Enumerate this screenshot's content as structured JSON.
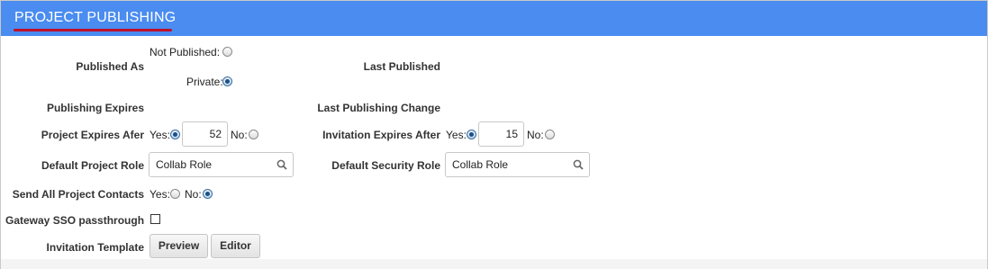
{
  "header": {
    "title": "PROJECT PUBLISHING"
  },
  "published_as": {
    "label": "Published As",
    "not_published_label": "Not Published:",
    "private_label": "Private:",
    "selected": "private"
  },
  "last_published": {
    "label": "Last Published"
  },
  "publishing_expires": {
    "label": "Publishing Expires"
  },
  "last_publishing_change": {
    "label": "Last Publishing Change"
  },
  "project_expires_after": {
    "label": "Project Expires Afer",
    "yes_label": "Yes:",
    "no_label": "No:",
    "selected": "yes",
    "value": "52"
  },
  "invitation_expires_after": {
    "label": "Invitation Expires After",
    "yes_label": "Yes:",
    "no_label": "No:",
    "selected": "yes",
    "value": "15"
  },
  "default_project_role": {
    "label": "Default Project Role",
    "value": "Collab Role"
  },
  "default_security_role": {
    "label": "Default Security Role",
    "value": "Collab Role"
  },
  "send_all_project_contacts": {
    "label": "Send All Project Contacts",
    "yes_label": "Yes:",
    "no_label": "No:",
    "selected": "no"
  },
  "gateway_sso": {
    "label": "Gateway SSO passthrough",
    "checked": false
  },
  "invitation_template": {
    "label": "Invitation Template",
    "preview_label": "Preview",
    "editor_label": "Editor"
  },
  "colors": {
    "header_bg": "#4a8cf0",
    "underline": "#c0102a",
    "radio_selected": "#1c4f86"
  }
}
